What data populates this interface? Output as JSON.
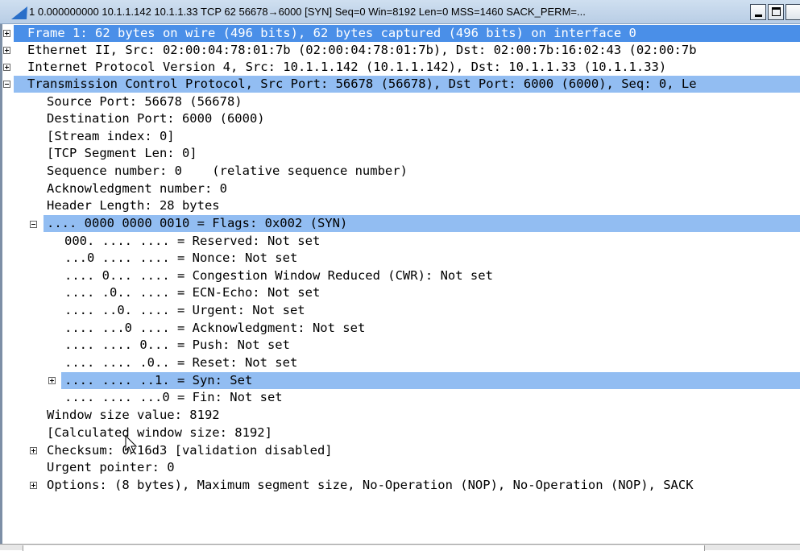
{
  "window": {
    "title": "1 0.000000000 10.1.1.142 10.1.1.33 TCP 62 56678→6000 [SYN] Seq=0 Win=8192 Len=0 MSS=1460 SACK_PERM=..."
  },
  "icons": {
    "app": "shark-fin-icon",
    "minimize": "minimize-icon",
    "maximize": "maximize-icon"
  },
  "colors": {
    "selected": "#4a8fe8",
    "highlight": "#92bdf2"
  },
  "tree": {
    "rows": [
      "Frame 1: 62 bytes on wire (496 bits), 62 bytes captured (496 bits) on interface 0",
      "Ethernet II, Src: 02:00:04:78:01:7b (02:00:04:78:01:7b), Dst: 02:00:7b:16:02:43 (02:00:7b",
      "Internet Protocol Version 4, Src: 10.1.1.142 (10.1.1.142), Dst: 10.1.1.33 (10.1.1.33)",
      "Transmission Control Protocol, Src Port: 56678 (56678), Dst Port: 6000 (6000), Seq: 0, Le",
      "Source Port: 56678 (56678)",
      "Destination Port: 6000 (6000)",
      "[Stream index: 0]",
      "[TCP Segment Len: 0]",
      "Sequence number: 0    (relative sequence number)",
      "Acknowledgment number: 0",
      "Header Length: 28 bytes",
      ".... 0000 0000 0010 = Flags: 0x002 (SYN)",
      "000. .... .... = Reserved: Not set",
      "...0 .... .... = Nonce: Not set",
      ".... 0... .... = Congestion Window Reduced (CWR): Not set",
      ".... .0.. .... = ECN-Echo: Not set",
      ".... ..0. .... = Urgent: Not set",
      ".... ...0 .... = Acknowledgment: Not set",
      ".... .... 0... = Push: Not set",
      ".... .... .0.. = Reset: Not set",
      ".... .... ..1. = Syn: Set",
      ".... .... ...0 = Fin: Not set",
      "Window size value: 8192",
      "[Calculated window size: 8192]",
      "Checksum: 0x16d3 [validation disabled]",
      "Urgent pointer: 0",
      "Options: (8 bytes), Maximum segment size, No-Operation (NOP), No-Operation (NOP), SACK"
    ]
  }
}
